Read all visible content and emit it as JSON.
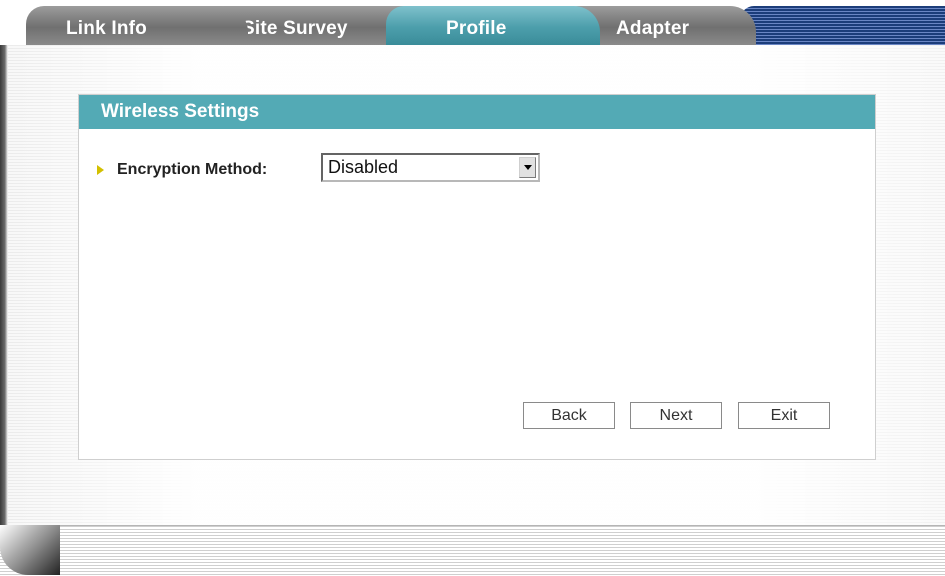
{
  "tabs": [
    {
      "label": "Link Info",
      "active": false
    },
    {
      "label": "Site Survey",
      "active": false
    },
    {
      "label": "Profile",
      "active": true
    },
    {
      "label": "Adapter",
      "active": false
    }
  ],
  "panel": {
    "title": "Wireless Settings",
    "encryption": {
      "label": "Encryption Method:",
      "value": "Disabled"
    },
    "buttons": {
      "back": "Back",
      "next": "Next",
      "exit": "Exit"
    }
  },
  "colors": {
    "accent": "#53aab5",
    "tab_gray": "#7a7a7a",
    "stripe_blue": "#1c3d7a",
    "bullet": "#d3c000"
  },
  "icons": {
    "bullet": "arrow-bullet-icon",
    "dropdown": "chevron-down-icon"
  }
}
